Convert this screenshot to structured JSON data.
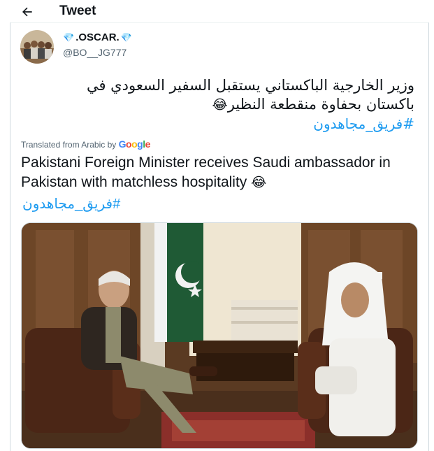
{
  "header": {
    "title": "Tweet"
  },
  "user": {
    "display_name": ".OSCAR.",
    "handle": "@BO__JG777"
  },
  "tweet": {
    "arabic_line1": "وزير الخارجية الباكستاني  يستقبل السفير السعودي في",
    "arabic_line2": "باكستان بحفاوة منقطعة النظير",
    "hashtag": "#فريق_مجاهدون",
    "translated_label": "Translated from Arabic by",
    "translator": "Google",
    "english_text": "Pakistani Foreign Minister receives Saudi ambassador in Pakistan with matchless hospitality",
    "emoji": "😂"
  },
  "colors": {
    "link": "#1d9bf0",
    "muted": "#536471",
    "text": "#0f1419",
    "border": "#cfd9de"
  },
  "icons": {
    "back": "arrow-left-icon",
    "verified_gem": "diamond-icon"
  }
}
